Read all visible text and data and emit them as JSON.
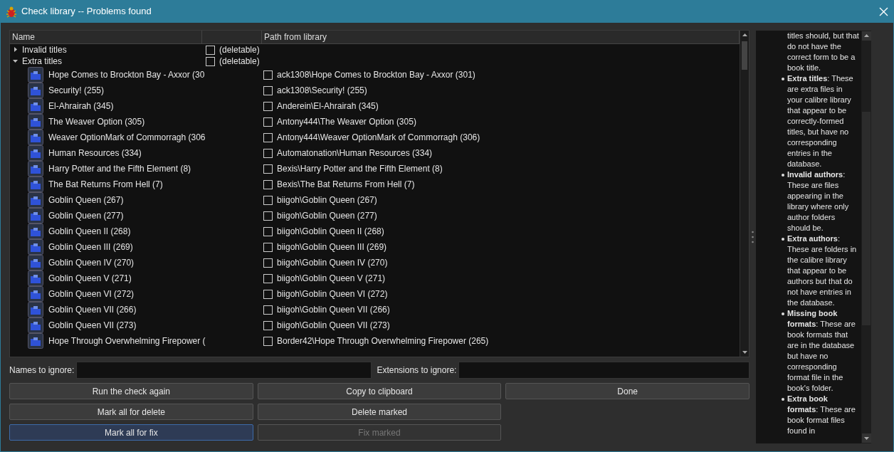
{
  "window": {
    "title": "Check library -- Problems found"
  },
  "tree": {
    "columns": [
      "Name",
      "",
      "Path from library"
    ],
    "groups": [
      {
        "label": "Invalid titles",
        "expanded": false,
        "checked": false,
        "note": "(deletable)"
      },
      {
        "label": "Extra titles",
        "expanded": true,
        "checked": false,
        "note": "(deletable)",
        "children": [
          {
            "name": "Hope Comes to Brockton Bay - Axxor (30",
            "path": "ack1308\\Hope Comes to Brockton Bay - Axxor (301)",
            "checked": false
          },
          {
            "name": "Security! (255)",
            "path": "ack1308\\Security! (255)",
            "checked": false
          },
          {
            "name": "El-Ahrairah (345)",
            "path": "Anderein\\El-Ahrairah (345)",
            "checked": false
          },
          {
            "name": "The Weaver Option (305)",
            "path": "Antony444\\The Weaver Option (305)",
            "checked": false
          },
          {
            "name": "Weaver OptionMark of Commorragh (306",
            "path": "Antony444\\Weaver OptionMark of Commorragh (306)",
            "checked": false
          },
          {
            "name": "Human Resources (334)",
            "path": "Automatonation\\Human Resources (334)",
            "checked": false
          },
          {
            "name": "Harry Potter and the Fifth Element (8)",
            "path": "Bexis\\Harry Potter and the Fifth Element (8)",
            "checked": false
          },
          {
            "name": "The Bat Returns From Hell (7)",
            "path": "Bexis\\The Bat Returns From Hell (7)",
            "checked": false
          },
          {
            "name": "Goblin Queen (267)",
            "path": "biigoh\\Goblin Queen (267)",
            "checked": false
          },
          {
            "name": "Goblin Queen (277)",
            "path": "biigoh\\Goblin Queen (277)",
            "checked": false
          },
          {
            "name": "Goblin Queen II (268)",
            "path": "biigoh\\Goblin Queen II (268)",
            "checked": false
          },
          {
            "name": "Goblin Queen III (269)",
            "path": "biigoh\\Goblin Queen III (269)",
            "checked": false
          },
          {
            "name": "Goblin Queen IV (270)",
            "path": "biigoh\\Goblin Queen IV (270)",
            "checked": false
          },
          {
            "name": "Goblin Queen V (271)",
            "path": "biigoh\\Goblin Queen V (271)",
            "checked": false
          },
          {
            "name": "Goblin Queen VI (272)",
            "path": "biigoh\\Goblin Queen VI (272)",
            "checked": false
          },
          {
            "name": "Goblin Queen VII (266)",
            "path": "biigoh\\Goblin Queen VII (266)",
            "checked": false
          },
          {
            "name": "Goblin Queen VII (273)",
            "path": "biigoh\\Goblin Queen VII (273)",
            "checked": false
          },
          {
            "name": "Hope Through Overwhelming Firepower (",
            "path": "Border42\\Hope Through Overwhelming Firepower (265)",
            "checked": false
          }
        ]
      }
    ]
  },
  "ignore_fields": [
    {
      "label": "Names to ignore:"
    },
    {
      "label": "Extensions to ignore:"
    }
  ],
  "buttons": [
    {
      "label": "Run the check again",
      "disabled": false,
      "focused": false
    },
    {
      "label": "Copy to clipboard",
      "disabled": false,
      "focused": false
    },
    {
      "label": "Done",
      "disabled": false,
      "focused": false
    },
    {
      "label": "Mark all for delete",
      "disabled": false,
      "focused": false
    },
    {
      "label": "Delete marked",
      "disabled": false,
      "focused": false
    },
    {
      "label": "Mark all for fix",
      "disabled": false,
      "focused": true
    },
    {
      "label": "Fix marked",
      "disabled": true,
      "focused": false
    }
  ],
  "help": [
    {
      "text": "titles should, but that do not have the correct form to be a book title.",
      "bullet": false
    },
    {
      "text": "**Extra titles**: These are extra files in your calibre library that appear to be correctly-formed titles, but have no corresponding entries in the database.",
      "bullet": true
    },
    {
      "text": "**Invalid authors**: These are files appearing in the library where only author folders should be.",
      "bullet": true
    },
    {
      "text": "**Extra authors**: These are folders in the calibre library that appear to be authors but that do not have entries in the database.",
      "bullet": true
    },
    {
      "text": "**Missing book formats**: These are book formats that are in the database but have no corresponding format file in the book's folder.",
      "bullet": true
    },
    {
      "text": "**Extra book formats**: These are book format files found in",
      "bullet": true
    }
  ]
}
